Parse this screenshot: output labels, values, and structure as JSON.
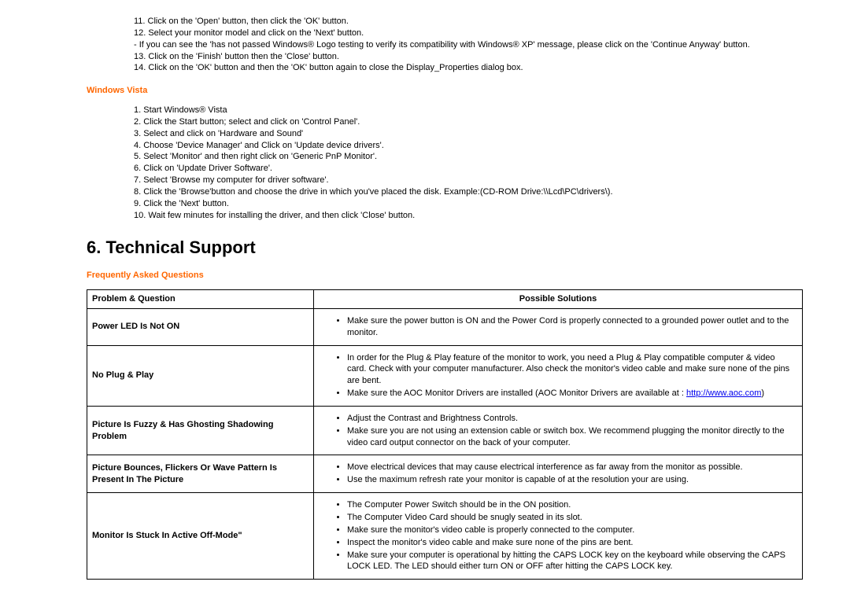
{
  "xp_steps": {
    "s11": "11. Click on the 'Open' button, then click the 'OK' button.",
    "s12": "12. Select your monitor model and click on the 'Next' button.",
    "note": "- If you can see the 'has not passed Windows® Logo testing to verify its compatibility with Windows® XP' message, please click on the 'Continue Anyway' button.",
    "s13": "13. Click on the 'Finish' button then the 'Close' button.",
    "s14": "14. Click on the 'OK' button and then the 'OK' button again to close the Display_Properties dialog box."
  },
  "vista_heading": "Windows Vista",
  "vista_steps": {
    "s1": "1. Start Windows® Vista",
    "s2": "2. Click the Start button; select and click on 'Control Panel'.",
    "s3": "3. Select and click on 'Hardware and Sound'",
    "s4": "4. Choose 'Device Manager' and Click on 'Update device drivers'.",
    "s5": "5. Select 'Monitor' and then right click on 'Generic PnP Monitor'.",
    "s6": "6. Click on 'Update Driver Software'.",
    "s7": "7. Select 'Browse my computer for driver software'.",
    "s8": "8. Click the 'Browse'button and choose the drive in which you've placed the disk. Example:(CD-ROM Drive:\\\\Lcd\\PC\\drivers\\).",
    "s9": "9. Click the 'Next' button.",
    "s10": "10. Wait few minutes for installing the driver, and then click 'Close' button."
  },
  "tech_heading": "6. Technical Support",
  "faq_heading": "Frequently Asked Questions",
  "table": {
    "head_problem": "Problem & Question",
    "head_solution": "Possible Solutions",
    "rows": [
      {
        "problem": "Power LED Is Not ON",
        "solutions": [
          "Make sure the power button is ON and the Power Cord is properly connected to a grounded power outlet and to the monitor."
        ]
      },
      {
        "problem": "No Plug & Play",
        "solutions": [
          "In order for the Plug & Play feature of the monitor to work, you need a Plug & Play compatible computer & video card.  Check with your computer manufacturer. Also check the monitor's video cable and make sure none of the pins are bent.",
          "Make sure the AOC Monitor Drivers are installed (AOC Monitor Drivers are available at : "
        ],
        "link_text": "http://www.aoc.com",
        "link_after": ")"
      },
      {
        "problem": "Picture Is Fuzzy & Has Ghosting Shadowing Problem",
        "solutions": [
          "Adjust the Contrast and Brightness Controls.",
          "Make sure you are not using an extension cable or switch box. We recommend plugging the monitor directly to the video card output connector on the back of your computer."
        ]
      },
      {
        "problem": "Picture Bounces, Flickers Or Wave Pattern Is Present In The Picture",
        "solutions": [
          "Move electrical devices that may cause electrical interference as far away from the monitor as possible.",
          "Use the maximum refresh rate your monitor is capable of at the resolution your are using."
        ]
      },
      {
        "problem": "Monitor Is Stuck In Active Off-Mode\"",
        "solutions": [
          "The Computer Power Switch should be in the ON position.",
          "The Computer Video Card should be snugly seated in its slot.",
          "Make sure the monitor's video cable is properly connected to the computer.",
          "Inspect the monitor's video cable and make sure none of the pins are bent.",
          "Make sure your computer is operational by hitting the CAPS LOCK key on the keyboard while observing the CAPS LOCK LED. The LED should either turn ON or OFF after hitting the CAPS LOCK key."
        ]
      }
    ]
  }
}
